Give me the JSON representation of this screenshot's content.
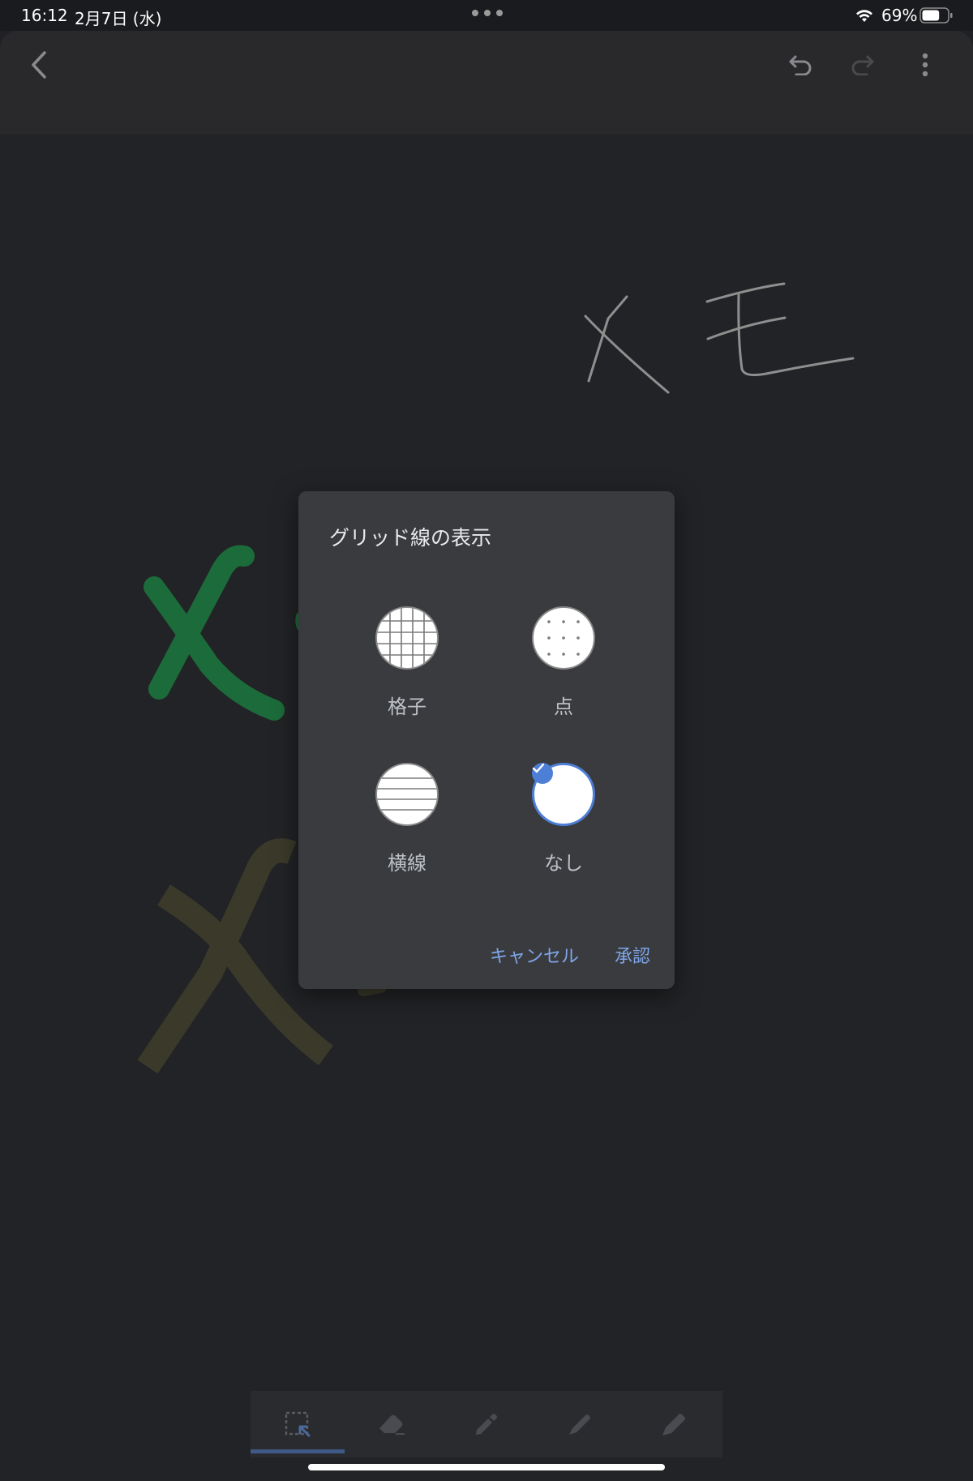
{
  "status_bar": {
    "time": "16:12",
    "date": "2月7日 (水)",
    "battery_percent": "69%",
    "battery_level": 0.69
  },
  "top_bar": {
    "back_icon": "chevron-left-icon",
    "undo_icon": "undo-icon",
    "redo_icon": "redo-icon",
    "menu_icon": "more-vert-icon"
  },
  "canvas": {
    "handwriting_text": "メモ",
    "stroke_colors": {
      "handwriting_gray": "#9a9a9a",
      "green_marker": "#1c6b3a",
      "olive_highlighter": "#3b3a2a"
    }
  },
  "dialog": {
    "title": "グリッド線の表示",
    "options": [
      {
        "label": "格子",
        "icon": "grid-icon",
        "selected": false
      },
      {
        "label": "点",
        "icon": "dots-icon",
        "selected": false
      },
      {
        "label": "横線",
        "icon": "lines-icon",
        "selected": false
      },
      {
        "label": "なし",
        "icon": "blank-icon",
        "selected": true
      }
    ],
    "cancel_label": "キャンセル",
    "ok_label": "承認",
    "accent_color": "#4e7fd6"
  },
  "toolbar": {
    "tools": [
      "select-icon",
      "eraser-icon",
      "pen-icon",
      "marker-icon",
      "highlighter-icon"
    ],
    "active_tool": "select-icon"
  }
}
